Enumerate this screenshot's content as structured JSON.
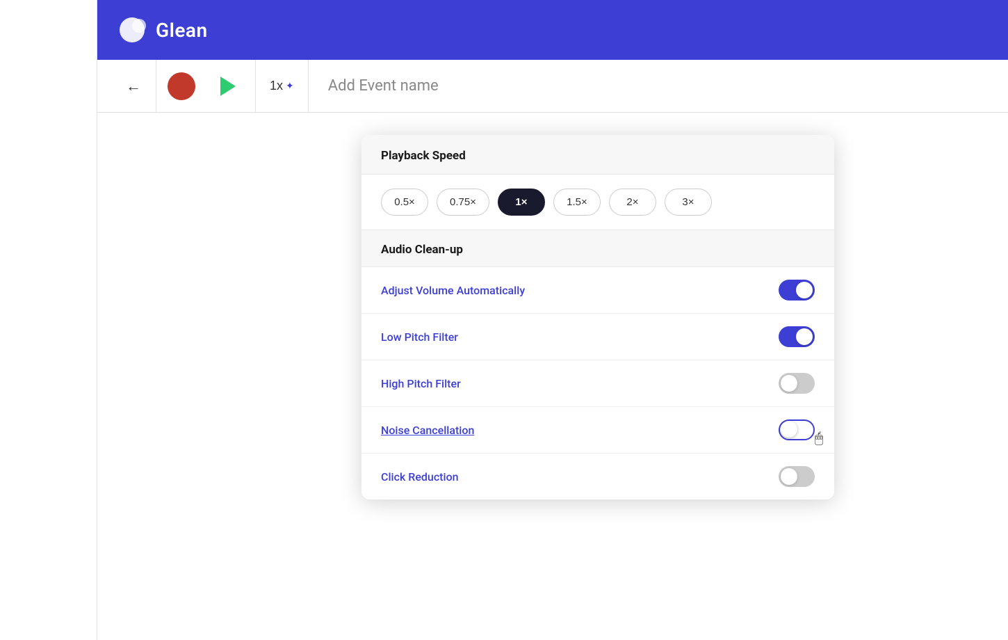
{
  "header": {
    "title": "Glean",
    "logo_alt": "Glean logo"
  },
  "toolbar": {
    "back_label": "←",
    "event_name_placeholder": "Add Event name",
    "speed_label": "1x",
    "speed_star": "✦"
  },
  "dropdown": {
    "playback_speed_section": "Playback Speed",
    "audio_cleanup_section": "Audio Clean-up",
    "speed_options": [
      {
        "label": "0.5×",
        "active": false
      },
      {
        "label": "0.75×",
        "active": false
      },
      {
        "label": "1×",
        "active": true
      },
      {
        "label": "1.5×",
        "active": false
      },
      {
        "label": "2×",
        "active": false
      },
      {
        "label": "3×",
        "active": false
      }
    ],
    "toggles": [
      {
        "label": "Adjust Volume Automatically",
        "state": "on",
        "type": "normal"
      },
      {
        "label": "Low Pitch Filter",
        "state": "on",
        "type": "normal"
      },
      {
        "label": "High Pitch Filter",
        "state": "off",
        "type": "normal"
      },
      {
        "label": "Noise Cancellation",
        "state": "focus",
        "type": "noise"
      },
      {
        "label": "Click Reduction",
        "state": "off",
        "type": "normal"
      }
    ]
  },
  "colors": {
    "brand": "#3d3fd4",
    "header_bg": "#3d3fd4",
    "record_red": "#c0392b",
    "play_green": "#2ecc71",
    "toggle_on": "#3d3fd4",
    "toggle_off": "#cccccc",
    "active_speed_bg": "#1a1a2e"
  }
}
